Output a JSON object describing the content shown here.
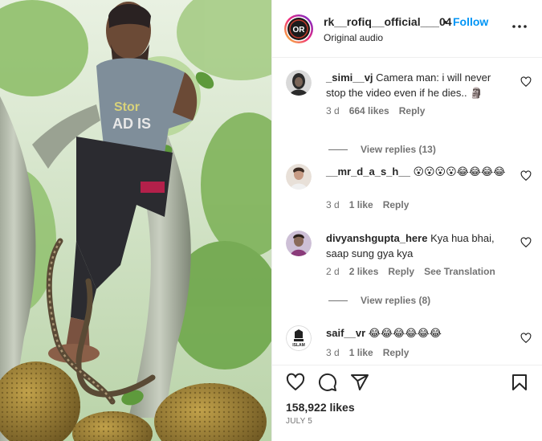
{
  "post": {
    "username": "rk__rofiq__official___04",
    "follow_separator": "•",
    "follow_label": "Follow",
    "audio_label": "Original audio",
    "avatar_text": "OR",
    "likes_text": "158,922 likes",
    "date_text": "JULY 5"
  },
  "video": {
    "shirt_text_1": "Stor",
    "shirt_text_2": "AD IS"
  },
  "comments": [
    {
      "user": "_simi__vj",
      "text": "Camera man: i will never stop the video even if he dies.. 🗿",
      "time": "3 d",
      "likes": "664 likes",
      "reply_label": "Reply",
      "view_replies": "View replies (13)"
    },
    {
      "user": "__mr_d_a_s_h__",
      "text": "😮😮😮😮😂😂😂😂",
      "time": "3 d",
      "likes": "1 like",
      "reply_label": "Reply"
    },
    {
      "user": "divyanshgupta_here",
      "text": "Kya hua bhai, saap sung gya kya",
      "time": "2 d",
      "likes": "2 likes",
      "reply_label": "Reply",
      "translation_label": "See Translation",
      "view_replies": "View replies (8)"
    },
    {
      "user": "saif__vr",
      "text": "😂😂😂😂😂😂",
      "time": "3 d",
      "likes": "1 like",
      "reply_label": "Reply",
      "avatar_text": "ISLAM"
    }
  ],
  "icons": {
    "more": "more-options-icon",
    "heart": "heart-icon",
    "comment": "comment-icon",
    "share": "share-icon",
    "save": "bookmark-icon"
  },
  "colors": {
    "follow": "#0095f6",
    "text": "#262626",
    "secondary": "#737373",
    "divider": "#efefef"
  }
}
